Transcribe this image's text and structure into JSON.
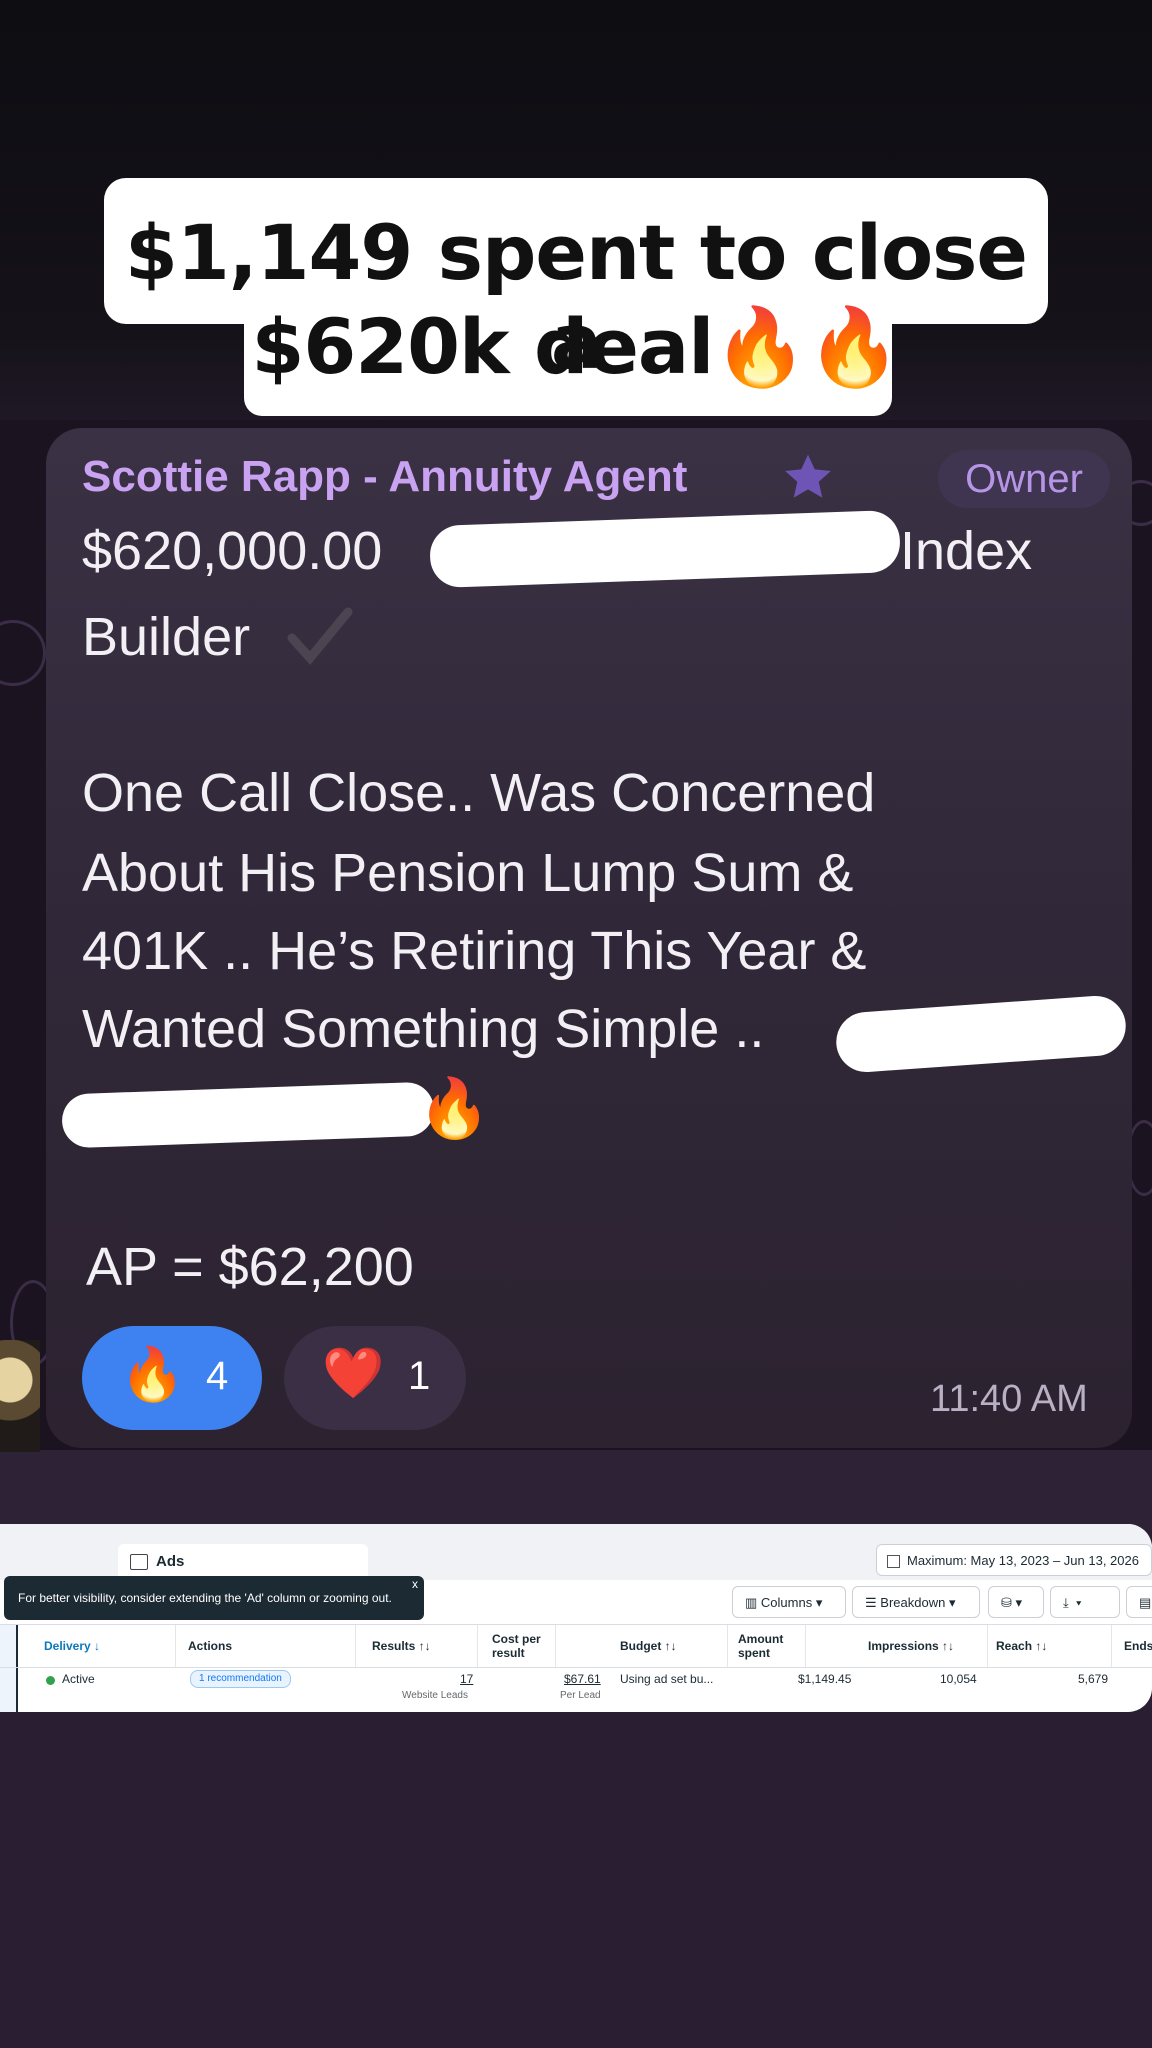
{
  "caption": {
    "line1": "$1,149 spent to close a",
    "line2": "$620k deal🔥🔥"
  },
  "message": {
    "sender": "Scottie Rapp - Annuity Agent",
    "role_badge": "Owner",
    "line1_start": "$620,000.00",
    "line1_end": "Index",
    "line2": "Builder",
    "body_lines": [
      "One Call Close.. Was Concerned",
      "About His Pension Lump Sum &",
      "401K .. He’s Retiring This Year &",
      "Wanted Something Simple .."
    ],
    "fire_emoji": "🔥",
    "ap_line": "AP = $62,200",
    "time": "11:40 AM",
    "reactions": [
      {
        "emoji": "🔥",
        "count": "4"
      },
      {
        "emoji": "❤️",
        "count": "1"
      }
    ],
    "icons": {
      "star": "star-icon",
      "check": "check-icon"
    },
    "colors": {
      "sender": "#c9a3f2",
      "bubble": "#332a3b",
      "fire_reaction": "#3d82f0"
    }
  },
  "ads_manager": {
    "tab_label": "Ads",
    "date_range": "Maximum: May 13, 2023 – Jun 13, 2026",
    "tooltip": "For better visibility, consider extending the 'Ad' column or zooming out.",
    "tooltip_close": "x",
    "toolbar": {
      "columns": "Columns",
      "breakdown": "Breakdown"
    },
    "headers": [
      "Delivery ↓",
      "Actions",
      "Results ↑↓",
      "Cost per result",
      "Budget ↑↓",
      "Amount spent",
      "Impressions ↑↓",
      "Reach ↑↓",
      "Ends"
    ],
    "row": {
      "delivery": "Active",
      "actions": "1 recommendation",
      "results": "17",
      "results_sub": "Website Leads",
      "cost_per_result": "$67.61",
      "cost_sub": "Per Lead",
      "budget": "Using ad set bu...",
      "amount_spent": "$1,149.45",
      "impressions": "10,054",
      "reach": "5,679"
    }
  }
}
